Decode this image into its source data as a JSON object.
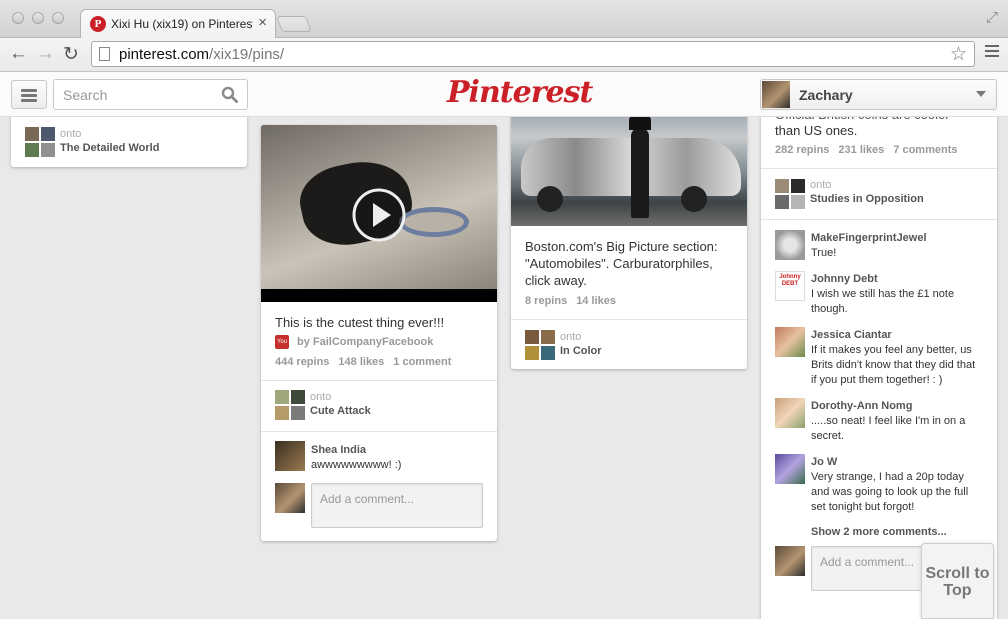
{
  "browser": {
    "tab_title": "Xixi Hu (xix19) on Pinterest",
    "url_host": "pinterest.com",
    "url_path": "/xix19/pins/"
  },
  "header": {
    "search_placeholder": "Search",
    "logo": "Pinterest",
    "user_name": "Zachary",
    "brand_color": "#cb2027"
  },
  "col1": {
    "onto": "onto",
    "board": "The Detailed World"
  },
  "col2": {
    "description": "This is the cutest thing ever!!!",
    "source": "by FailCompanyFacebook",
    "repins": "444 repins",
    "likes": "148 likes",
    "comments": "1 comment",
    "onto": "onto",
    "board": "Cute Attack",
    "comment_author": "Shea India",
    "comment_text": "awwwwwwwww! :)",
    "add_comment_placeholder": "Add a comment...",
    "play_icon": "play-icon"
  },
  "col3": {
    "description": "Boston.com's Big Picture section: \"Automobiles\". Carburatorphiles, click away.",
    "repins": "8 repins",
    "likes": "14 likes",
    "onto": "onto",
    "board": "In Color"
  },
  "col4": {
    "description_top_partial": "Official British coins are cooler",
    "description_line2": "than US ones.",
    "repins": "282 repins",
    "likes": "231 likes",
    "comments": "7 comments",
    "onto": "onto",
    "board": "Studies in Opposition",
    "comments_list": [
      {
        "author": "MakeFingerprintJewel",
        "text": "True!"
      },
      {
        "author": "Johnny Debt",
        "text": "I wish we still has the £1 note though."
      },
      {
        "author": "Jessica Ciantar",
        "text": "If it makes you feel any better, us Brits didn't know that they did that if you put them together! : )"
      },
      {
        "author": "Dorothy-Ann Nomg",
        "text": ".....so neat! I feel like I'm in on a secret."
      },
      {
        "author": "Jo W",
        "text": "Very strange, I had a 20p today and was going to look up the full set tonight but forgot!"
      }
    ],
    "avatar_label_johnny": "Johnny DEBT",
    "show_more": "Show 2 more comments...",
    "add_comment_placeholder": "Add a comment..."
  },
  "scroll_to_top": "Scroll to Top"
}
